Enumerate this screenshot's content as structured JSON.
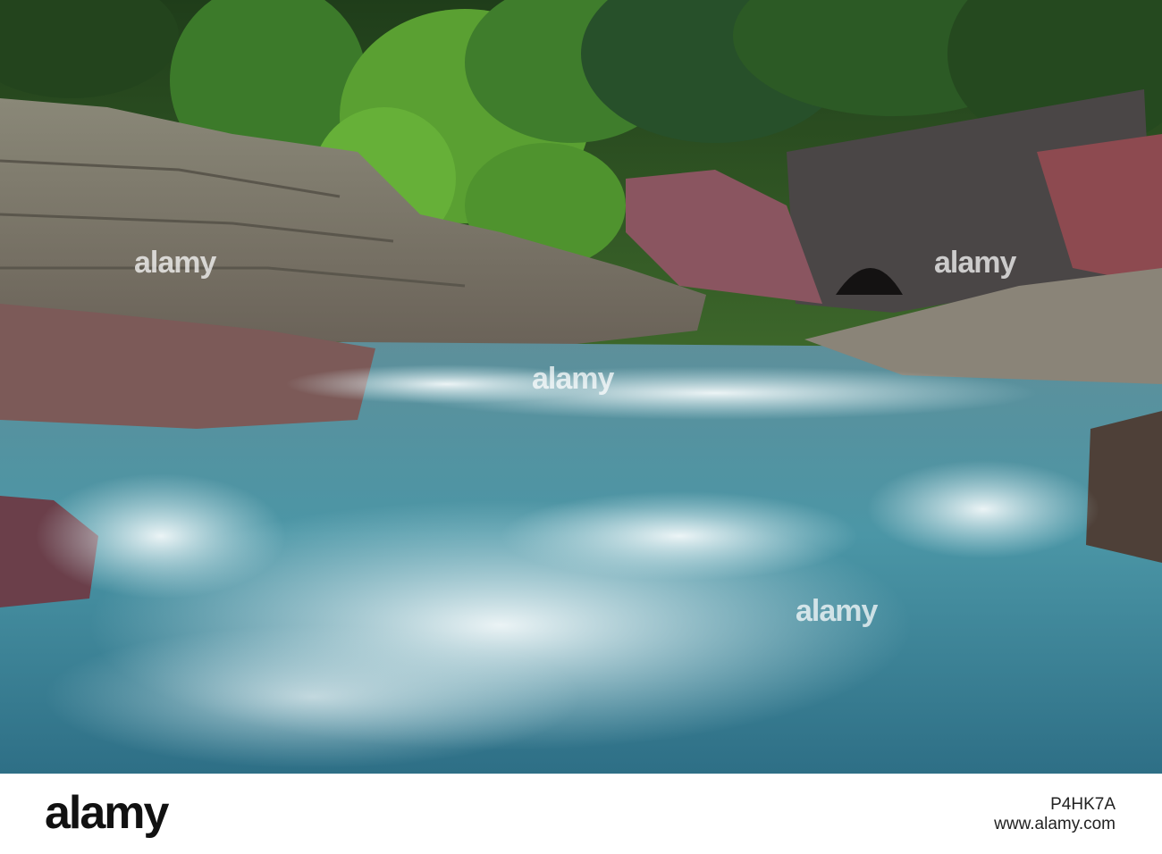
{
  "photo": {
    "subject": "river-cascade",
    "colors": {
      "forest": "#2f5a28",
      "water": "#3f8a9a",
      "rock": "#7a5560",
      "foam": "#e8f2f4"
    }
  },
  "watermark": {
    "text": "alamy"
  },
  "footer": {
    "brand": "alamy",
    "url": "www.alamy.com",
    "image_id": "P4HK7A"
  }
}
